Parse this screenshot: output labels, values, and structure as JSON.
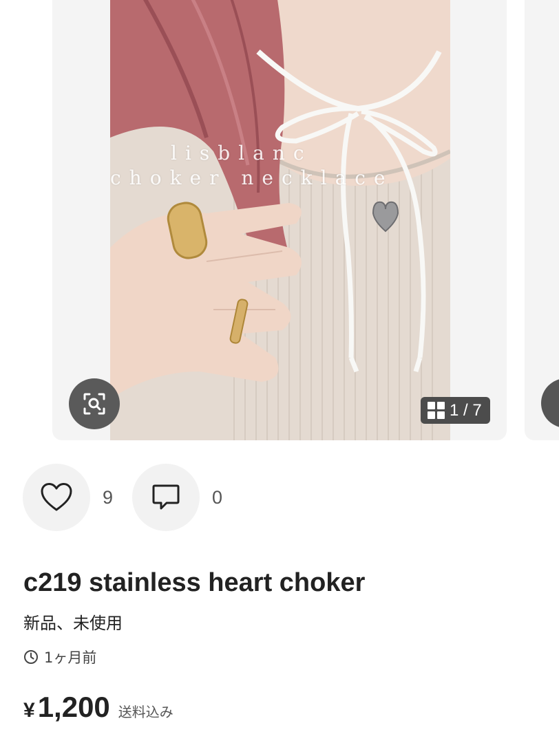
{
  "gallery": {
    "overlay_line1": "lisblanc",
    "overlay_line2": "choker necklace",
    "counter": "1 / 7"
  },
  "actions": {
    "like_count": "9",
    "comment_count": "0"
  },
  "item": {
    "title": "c219 stainless heart choker",
    "condition": "新品、未使用",
    "posted": "1ヶ月前",
    "currency": "¥",
    "price": "1,200",
    "shipping": "送料込み"
  },
  "colors": {
    "card_bg": "#f4f4f4",
    "button_dark": "#5a5a5a",
    "action_bg": "#f2f2f2",
    "text": "#222222"
  },
  "icons": [
    "lens-search-icon",
    "grid-icon",
    "heart-icon",
    "comment-icon",
    "clock-icon"
  ]
}
